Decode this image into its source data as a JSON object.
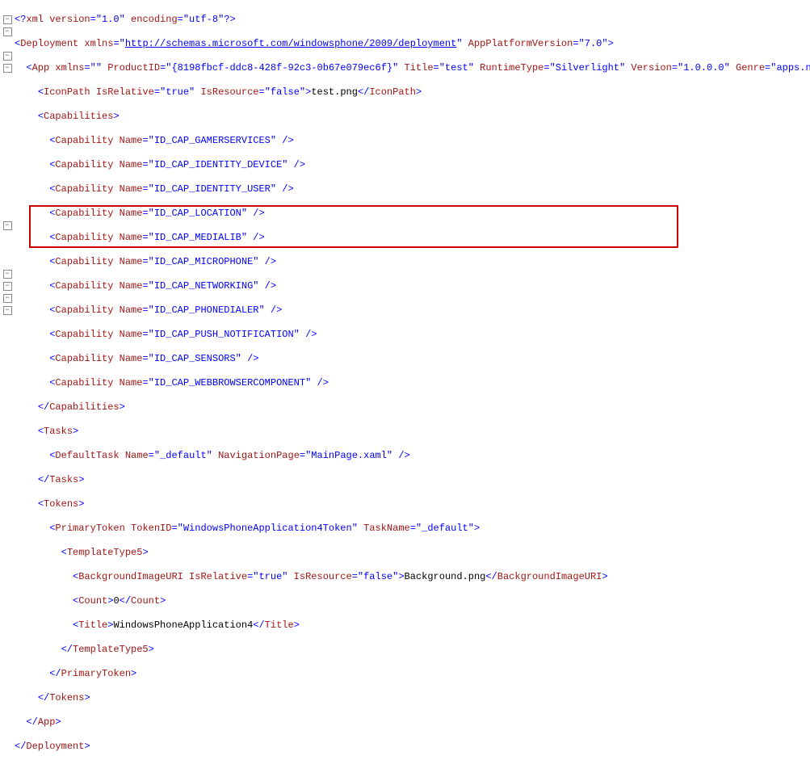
{
  "fold_rows": [
    1,
    2,
    4,
    5,
    18,
    22,
    23,
    24,
    25
  ],
  "code": {
    "xmlDeclPrefix": "<?",
    "xmlDeclName": "xml",
    "xmlVersionAttr": " version",
    "xmlVersionVal": "\"1.0\"",
    "xmlEncAttr": " encoding",
    "xmlEncVal": "\"utf-8\"",
    "xmlDeclSuffix": "?>",
    "deploymentOpen": "Deployment",
    "xmlnsAttr": " xmlns",
    "deploymentNs": "http://schemas.microsoft.com/windowsphone/2009/deployment",
    "appPlatAttr": " AppPlatformVersion",
    "appPlatVal": "\"7.0\"",
    "appOpen": "App",
    "appXmlnsVal": "\"\"",
    "productIdAttr": " ProductID",
    "productIdVal": "\"{8198fbcf-ddc8-428f-92c3-0b67e079ec6f}\"",
    "titleAttr": " Title",
    "titleVal": "\"test\"",
    "runtimeAttr": " RuntimeType",
    "runtimeVal": "\"Silverlight\"",
    "versionAttr": " Version",
    "versionVal": "\"1.0.0.0\"",
    "genreAttr": " Genre",
    "genreVal": "\"apps.normal",
    "iconPathOpen": "IconPath",
    "isRelAttr": " IsRelative",
    "trueVal": "\"true\"",
    "isResAttr": " IsResource",
    "falseVal": "\"false\"",
    "iconPathText": "test.png",
    "capabilitiesOpen": "Capabilities",
    "capabilityTag": "Capability",
    "nameAttr": " Name",
    "cap1": "\"ID_CAP_GAMERSERVICES\"",
    "cap2": "\"ID_CAP_IDENTITY_DEVICE\"",
    "cap3": "\"ID_CAP_IDENTITY_USER\"",
    "cap4": "\"ID_CAP_LOCATION\"",
    "cap5": "\"ID_CAP_MEDIALIB\"",
    "cap6": "\"ID_CAP_MICROPHONE\"",
    "cap7": "\"ID_CAP_NETWORKING\"",
    "cap8": "\"ID_CAP_PHONEDIALER\"",
    "cap9": "\"ID_CAP_PUSH_NOTIFICATION\"",
    "cap10": "\"ID_CAP_SENSORS\"",
    "cap11": "\"ID_CAP_WEBBROWSERCOMPONENT\"",
    "tasksOpen": "Tasks",
    "defaultTask": "DefaultTask",
    "defNameVal": "\"_default\"",
    "navPageAttr": " NavigationPage",
    "navPageVal": "\"MainPage.xaml\"",
    "tokensOpen": "Tokens",
    "primaryToken": "PrimaryToken",
    "tokenIdAttr": " TokenID",
    "tokenIdVal": "\"WindowsPhoneApplication4Token\"",
    "taskNameAttr": " TaskName",
    "templateType5": "TemplateType5",
    "bgImage": "BackgroundImageURI",
    "bgImageText": "Background.png",
    "countTag": "Count",
    "countText": "0",
    "titleTag": "Title",
    "titleText": "WindowsPhoneApplication4",
    "eq": "=",
    "lt": "<",
    "gt": ">",
    "ltSlash": "</",
    "spSlashGt": " />",
    "quote": "\""
  }
}
